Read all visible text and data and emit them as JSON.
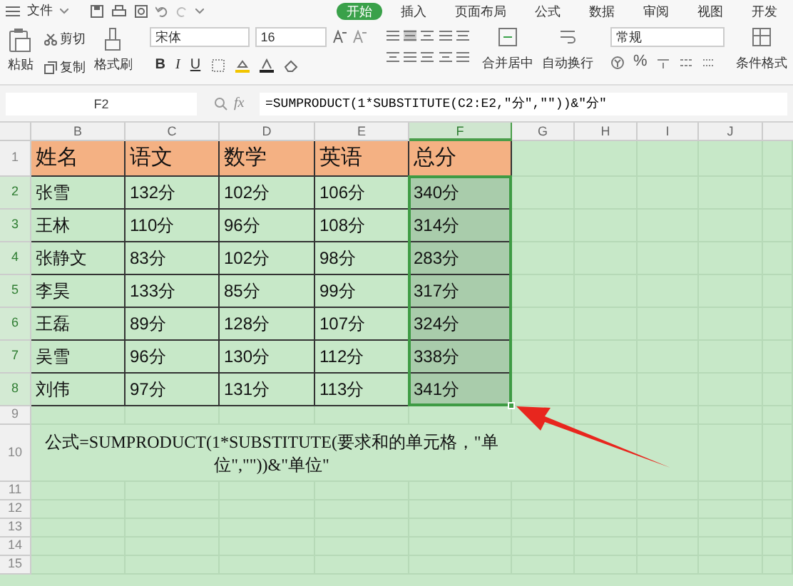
{
  "menu_bar": {
    "file_menu": "文件",
    "tabs": [
      {
        "label": "开始",
        "selected": true
      },
      {
        "label": "插入",
        "selected": false
      },
      {
        "label": "页面布局",
        "selected": false
      },
      {
        "label": "公式",
        "selected": false
      },
      {
        "label": "数据",
        "selected": false
      },
      {
        "label": "审阅",
        "selected": false
      },
      {
        "label": "视图",
        "selected": false
      },
      {
        "label": "开发",
        "selected": false
      }
    ]
  },
  "ribbon": {
    "paste": "粘贴",
    "cut": "剪切",
    "copy": "复制",
    "format_painter": "格式刷",
    "font_name": "宋体",
    "font_size": "16",
    "bold": "B",
    "italic": "I",
    "underline": "U",
    "merge": "合并居中",
    "wrap_text": "自动换行",
    "number_format": "常规",
    "percent": "%",
    "conditional_format": "条件格式"
  },
  "formula_bar": {
    "cell_ref": "F2",
    "fx": "fx",
    "formula": "=SUMPRODUCT(1*SUBSTITUTE(C2:E2,\"分\",\"\"))&\"分\""
  },
  "sheet": {
    "columns": [
      {
        "label": "B",
        "selected": false
      },
      {
        "label": "C",
        "selected": false
      },
      {
        "label": "D",
        "selected": false
      },
      {
        "label": "E",
        "selected": false
      },
      {
        "label": "F",
        "selected": true
      },
      {
        "label": "G",
        "selected": false
      },
      {
        "label": "H",
        "selected": false
      },
      {
        "label": "I",
        "selected": false
      },
      {
        "label": "J",
        "selected": false
      }
    ],
    "rows": [
      {
        "label": "1",
        "kind": "header",
        "selected": false,
        "cells": [
          "姓名",
          "语文",
          "数学",
          "英语",
          "总分"
        ]
      },
      {
        "label": "2",
        "kind": "data",
        "selected": true,
        "cells": [
          "张雪",
          "132分",
          "102分",
          "106分",
          "340分"
        ]
      },
      {
        "label": "3",
        "kind": "data",
        "selected": true,
        "cells": [
          "王林",
          "110分",
          "96分",
          "108分",
          "314分"
        ]
      },
      {
        "label": "4",
        "kind": "data",
        "selected": true,
        "cells": [
          "张静文",
          "83分",
          "102分",
          "98分",
          "283分"
        ]
      },
      {
        "label": "5",
        "kind": "data",
        "selected": true,
        "cells": [
          "李昊",
          "133分",
          "85分",
          "99分",
          "317分"
        ]
      },
      {
        "label": "6",
        "kind": "data",
        "selected": true,
        "cells": [
          "王磊",
          "89分",
          "128分",
          "107分",
          "324分"
        ]
      },
      {
        "label": "7",
        "kind": "data",
        "selected": true,
        "cells": [
          "吴雪",
          "96分",
          "130分",
          "112分",
          "338分"
        ]
      },
      {
        "label": "8",
        "kind": "data",
        "selected": true,
        "cells": [
          "刘伟",
          "97分",
          "131分",
          "113分",
          "341分"
        ]
      },
      {
        "label": "9",
        "kind": "blank",
        "selected": false,
        "cells": []
      },
      {
        "label": "10",
        "kind": "note",
        "selected": false,
        "cells": [
          "公式=SUMPRODUCT(1*SUBSTITUTE(要求和的单元格，\"单位\",\"\"))&\"单位\""
        ]
      },
      {
        "label": "11",
        "kind": "blank",
        "selected": false,
        "cells": []
      },
      {
        "label": "12",
        "kind": "blank",
        "selected": false,
        "cells": []
      },
      {
        "label": "13",
        "kind": "blank",
        "selected": false,
        "cells": []
      },
      {
        "label": "14",
        "kind": "blank",
        "selected": false,
        "cells": []
      },
      {
        "label": "15",
        "kind": "blank",
        "selected": false,
        "cells": []
      }
    ]
  }
}
